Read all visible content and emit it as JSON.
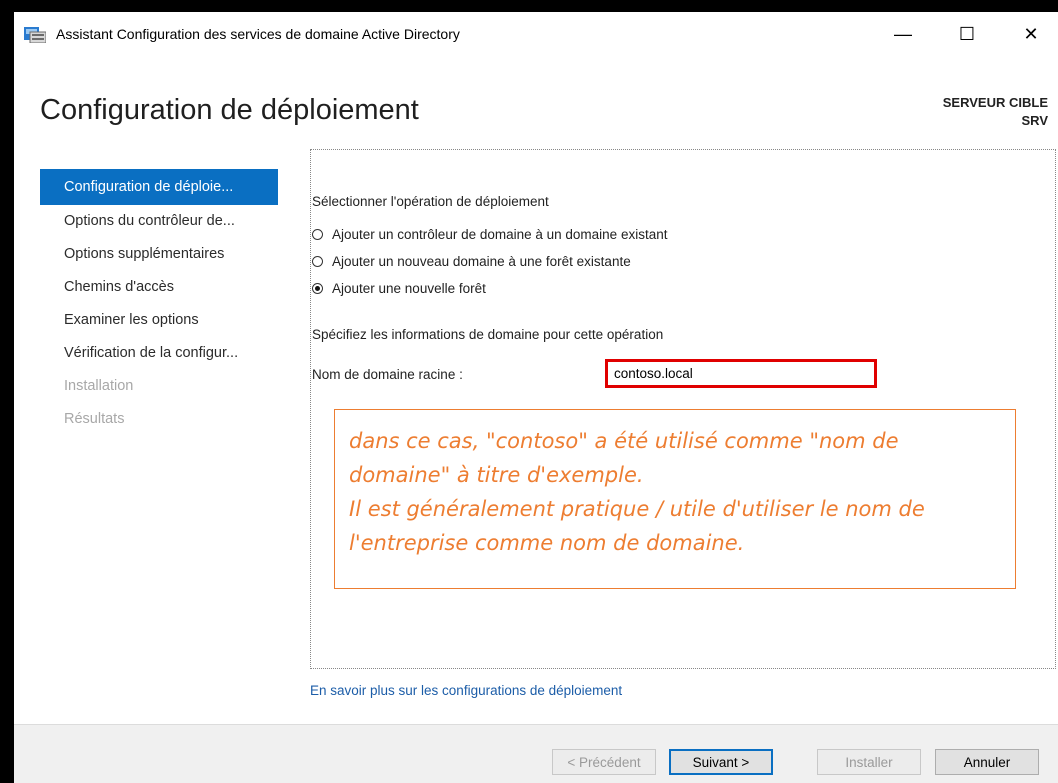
{
  "window": {
    "title": "Assistant Configuration des services de domaine Active Directory",
    "minimize_glyph": "—",
    "maximize_glyph": "☐",
    "close_glyph": "✕"
  },
  "header": {
    "page_title": "Configuration de déploiement",
    "server_label": "SERVEUR CIBLE",
    "server_name": "SRV"
  },
  "nav": {
    "items": [
      {
        "label": "Configuration de déploie..."
      },
      {
        "label": "Options du contrôleur de..."
      },
      {
        "label": "Options supplémentaires"
      },
      {
        "label": "Chemins d'accès"
      },
      {
        "label": "Examiner les options"
      },
      {
        "label": "Vérification de la configur..."
      },
      {
        "label": "Installation"
      },
      {
        "label": "Résultats"
      }
    ]
  },
  "deployment": {
    "operation_label": "Sélectionner l'opération de déploiement",
    "options": [
      {
        "label": "Ajouter un contrôleur de domaine à un domaine existant",
        "selected": false
      },
      {
        "label": "Ajouter un nouveau domaine à une forêt existante",
        "selected": false
      },
      {
        "label": "Ajouter une nouvelle forêt",
        "selected": true
      }
    ],
    "domain_info_label": "Spécifiez les informations de domaine pour cette opération",
    "root_domain_label": "Nom de domaine racine :",
    "root_domain_value": "contoso.local"
  },
  "note": {
    "lines": [
      "dans ce cas, \"contoso\" a été utilisé comme \"nom de",
      "domaine\" à titre d'exemple.",
      "Il est généralement pratique / utile d'utiliser le nom de",
      "l'entreprise comme nom de domaine."
    ]
  },
  "link": {
    "text": "En savoir plus sur les configurations de déploiement"
  },
  "buttons": {
    "previous": "< Précédent",
    "next": "Suivant >",
    "install": "Installer",
    "cancel": "Annuler"
  },
  "colors": {
    "accent": "#0a6fc2",
    "highlight_border": "#e00000",
    "note_orange": "#ed7d31",
    "link": "#1c5da8"
  }
}
